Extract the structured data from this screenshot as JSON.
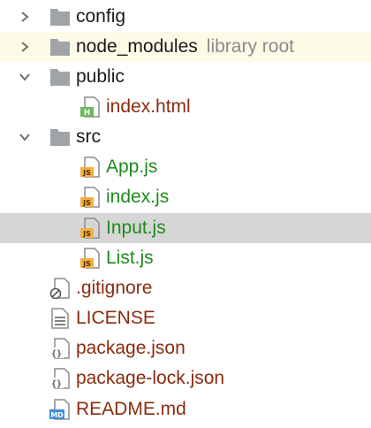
{
  "tree": {
    "config": {
      "label": "config"
    },
    "node_modules": {
      "label": "node_modules",
      "hint": "library root"
    },
    "public": {
      "label": "public"
    },
    "public_index": {
      "label": "index.html",
      "badge": "H"
    },
    "src": {
      "label": "src"
    },
    "app_js": {
      "label": "App.js",
      "badge": "JS"
    },
    "index_js": {
      "label": "index.js",
      "badge": "JS"
    },
    "input_js": {
      "label": "Input.js",
      "badge": "JS"
    },
    "list_js": {
      "label": "List.js",
      "badge": "JS"
    },
    "gitignore": {
      "label": ".gitignore"
    },
    "license": {
      "label": "LICENSE"
    },
    "package_json": {
      "label": "package.json"
    },
    "package_lock_json": {
      "label": "package-lock.json"
    },
    "readme": {
      "label": "README.md",
      "badge": "MD"
    }
  },
  "colors": {
    "folder": "#a0a4a8",
    "chevron": "#6e6e6e",
    "js_badge": "#f4b03e",
    "html_badge": "#6bb85a",
    "md_badge": "#3d8ed8",
    "excluded_row": "#fdfbe6",
    "selected_row": "#d6d6d6",
    "dir_text": "#1a1a1a",
    "tracked_text": "#1e8a1e",
    "untracked_text": "#8a2b0f"
  }
}
